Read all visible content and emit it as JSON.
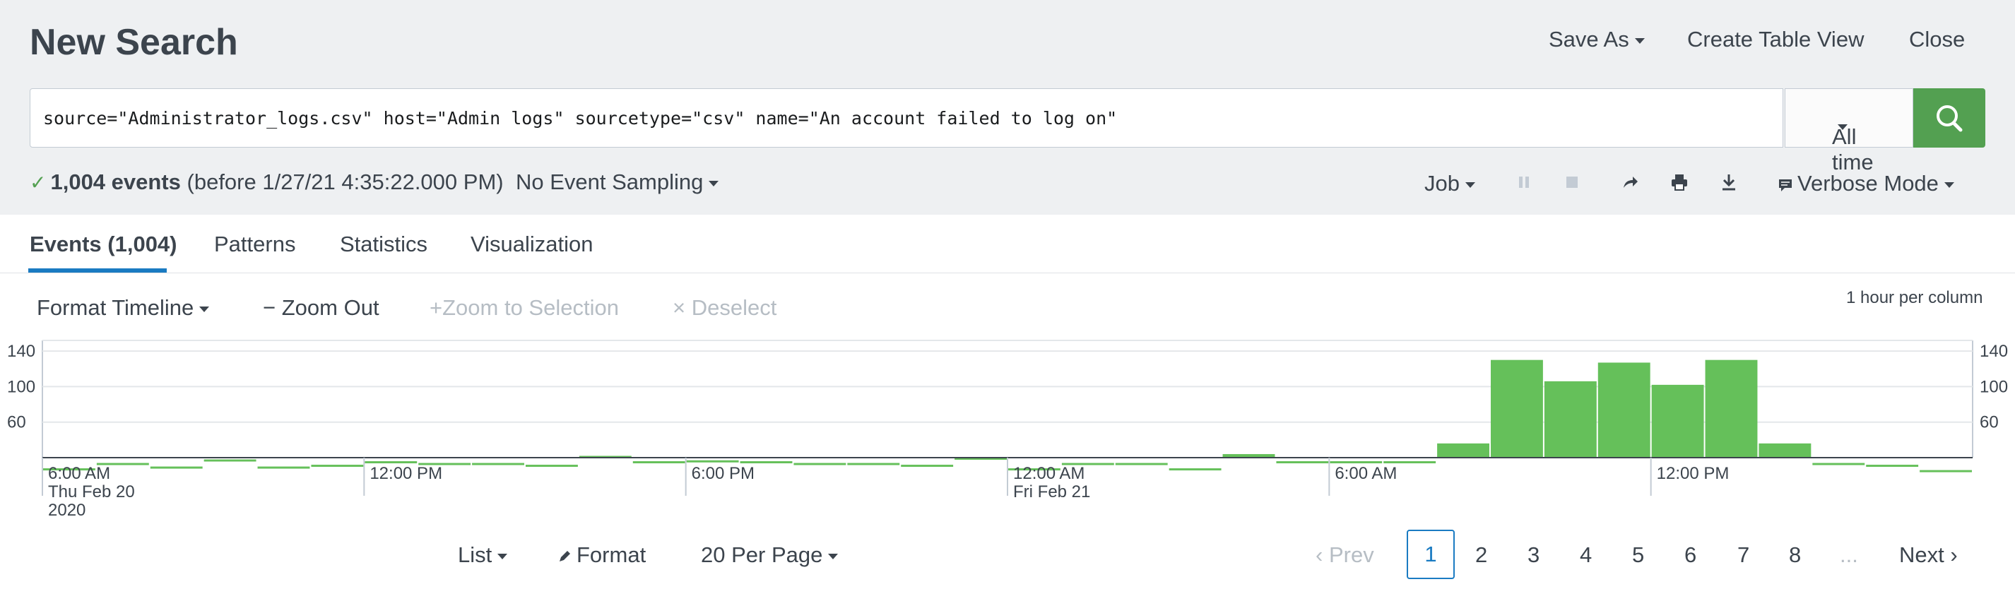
{
  "header": {
    "title": "New Search",
    "save_as": "Save As",
    "create_table_view": "Create Table View",
    "close": "Close"
  },
  "search": {
    "query": "source=\"Administrator_logs.csv\" host=\"Admin logs\" sourcetype=\"csv\" name=\"An account failed to log on\"",
    "time_range": "All time"
  },
  "status": {
    "event_count": "1,004 events",
    "before": "(before 1/27/21 4:35:22.000 PM)",
    "sampling": "No Event Sampling",
    "job": "Job",
    "mode": "Verbose Mode"
  },
  "tabs": [
    {
      "label": "Events (1,004)",
      "active": true
    },
    {
      "label": "Patterns"
    },
    {
      "label": "Statistics"
    },
    {
      "label": "Visualization"
    }
  ],
  "timeline": {
    "format": "Format Timeline",
    "zoom_out": "Zoom Out",
    "zoom_selection": "Zoom to Selection",
    "deselect": "Deselect",
    "per_column": "1 hour per column"
  },
  "chart_data": {
    "type": "bar",
    "y_ticks": [
      140,
      100,
      60
    ],
    "x_tick_labels": [
      {
        "line1": "6:00 AM",
        "line2": "Thu Feb 20",
        "line3": "2020"
      },
      {
        "line1": "12:00 PM"
      },
      {
        "line1": "6:00 PM"
      },
      {
        "line1": "12:00 AM",
        "line2": "Fri Feb 21"
      },
      {
        "line1": "6:00 AM"
      },
      {
        "line1": "12:00 PM"
      }
    ],
    "values": [
      8,
      14,
      10,
      18,
      10,
      12,
      16,
      14,
      14,
      12,
      22,
      16,
      17,
      16,
      14,
      14,
      12,
      20,
      8,
      14,
      14,
      8,
      24,
      16,
      16,
      16,
      36,
      130,
      106,
      127,
      102,
      130,
      36,
      14,
      12,
      6
    ],
    "bar_color": "#65c05a"
  },
  "results_bar": {
    "list": "List",
    "format": "Format",
    "per_page": "20 Per Page"
  },
  "pagination": {
    "prev": "Prev",
    "pages": [
      "1",
      "2",
      "3",
      "4",
      "5",
      "6",
      "7",
      "8"
    ],
    "ellipsis": "...",
    "next": "Next"
  }
}
